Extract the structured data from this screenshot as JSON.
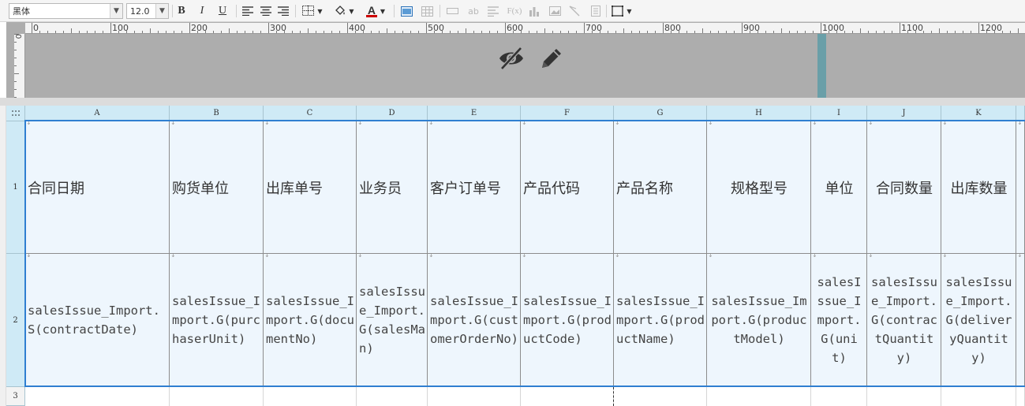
{
  "toolbar": {
    "font_name": "黑体",
    "font_size": "12.0",
    "bold": "B",
    "italic": "I",
    "underline": "U",
    "text_color_letter": "A",
    "text_color": "#cc0000",
    "formula_label": "F(x)",
    "ab_label": "ab"
  },
  "ruler": {
    "h_labels": [
      "0",
      "100",
      "200",
      "300",
      "400",
      "500",
      "600",
      "700",
      "800",
      "900",
      "1000",
      "1100",
      "1200"
    ],
    "v_labels": [
      "0"
    ]
  },
  "header_band": {
    "icons": [
      "eye-slash-icon",
      "pencil-icon"
    ]
  },
  "grid": {
    "corner_icon": "grid-handle-icon",
    "columns": [
      "A",
      "B",
      "C",
      "D",
      "E",
      "F",
      "G",
      "H",
      "I",
      "J",
      "K"
    ],
    "rows": [
      "1",
      "2",
      "3"
    ],
    "header_row": [
      "合同日期",
      "购货单位",
      "出库单号",
      "业务员",
      "客户订单号",
      "产品代码",
      "产品名称",
      "规格型号",
      "单位",
      "合同数量",
      "出库数量"
    ],
    "data_row": [
      "salesIssue_Import.S(contractDate)",
      "salesIssue_Import.G(purchaserUnit)",
      "salesIssue_Import.G(documentNo)",
      "salesIssue_Import.G(salesMan)",
      "salesIssue_Import.G(customerOrderNo)",
      "salesIssue_Import.G(productCode)",
      "salesIssue_Import.G(productName)",
      "salesIssue_Import.G(productModel)",
      "salesIssue_Import.G(unit)",
      "salesIssue_Import.G(contractQuantity)",
      "salesIssue_Import.G(deliveryQuantity)"
    ],
    "selection_color": "#2f7fd1"
  }
}
